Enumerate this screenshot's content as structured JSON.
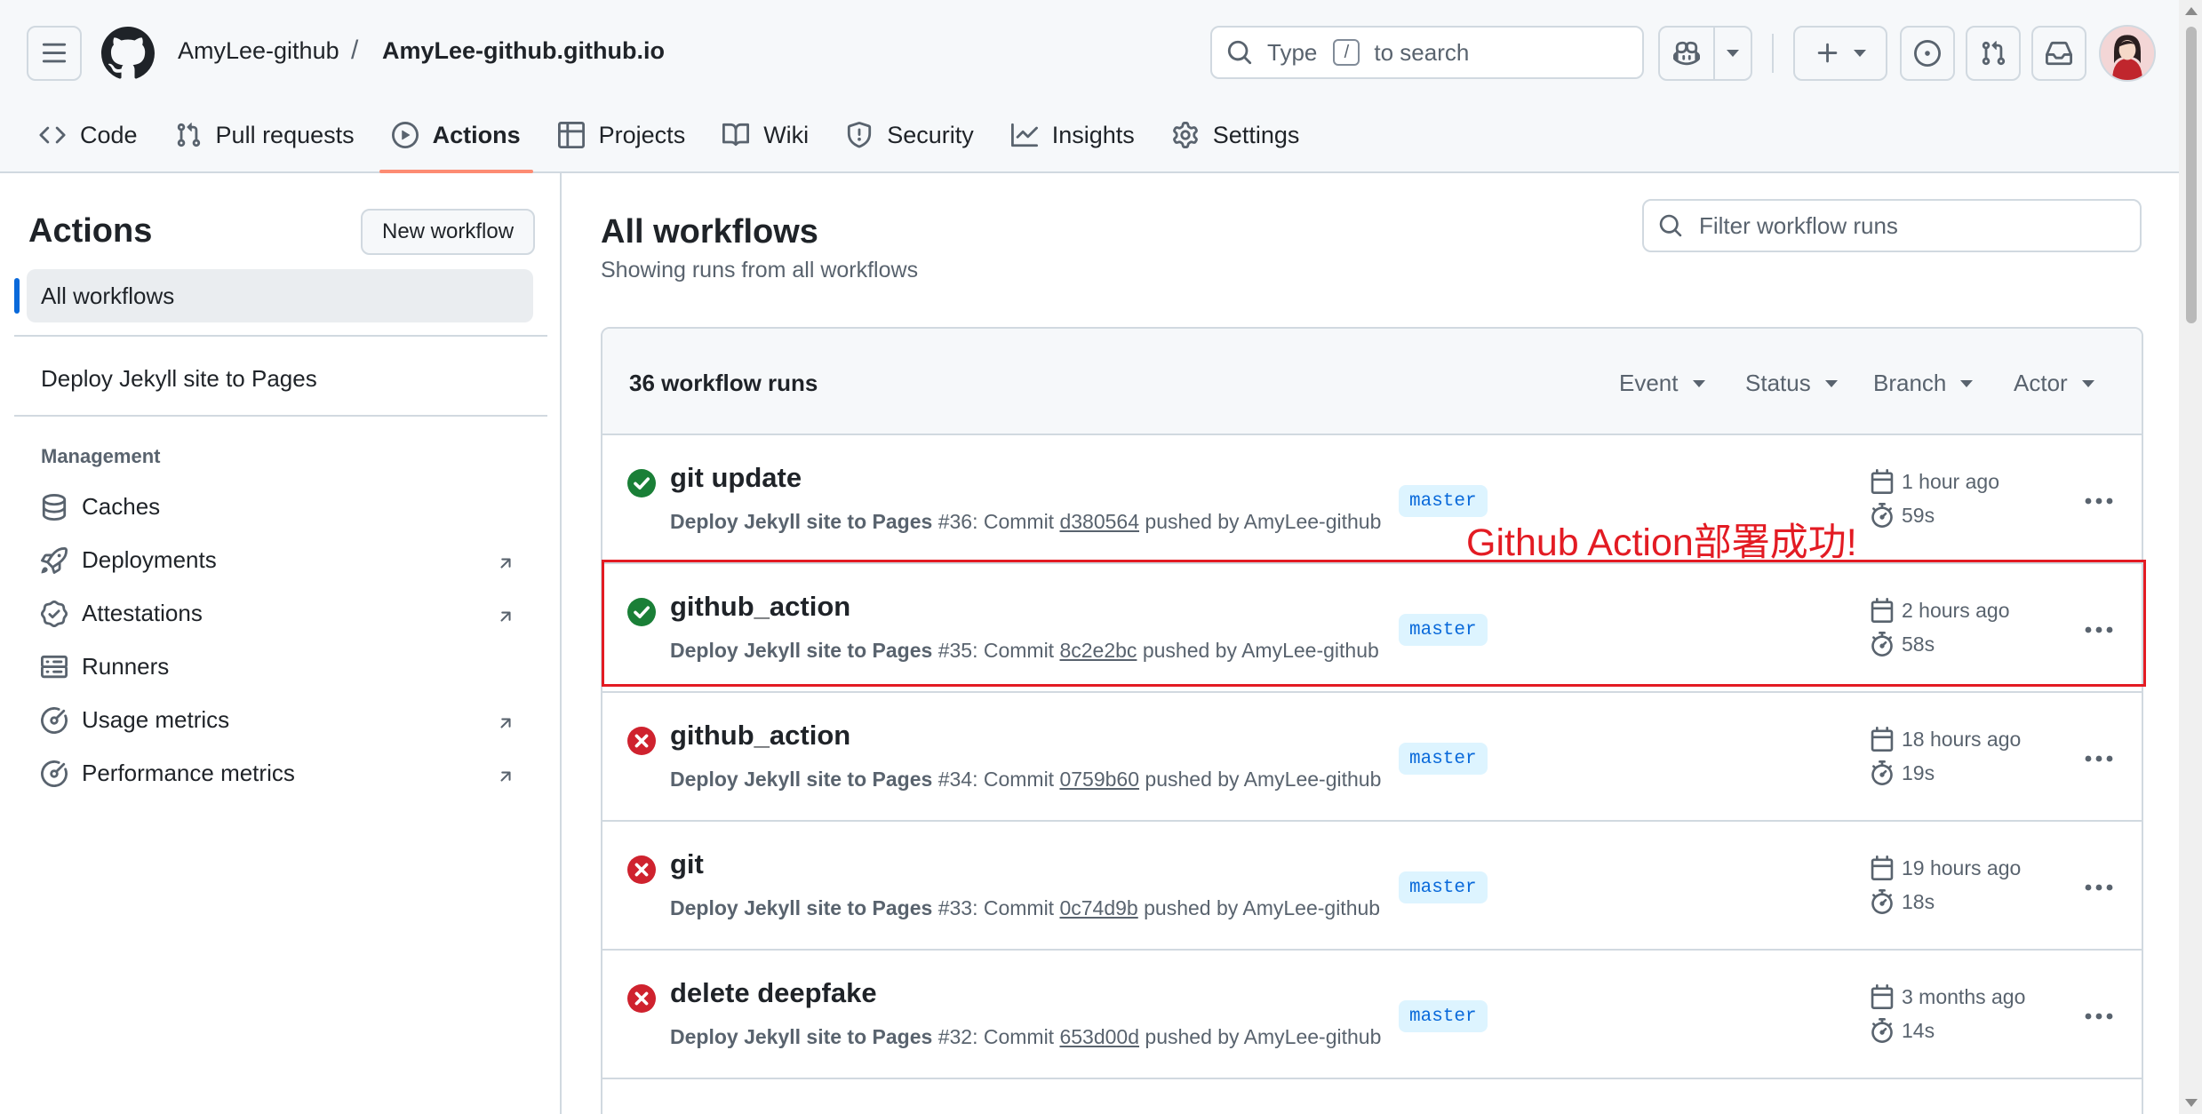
{
  "header": {
    "owner": "AmyLee-github",
    "separator": "/",
    "repo": "AmyLee-github.github.io",
    "search_prefix": "Type",
    "search_key": "/",
    "search_suffix": "to search"
  },
  "nav": {
    "tabs": [
      {
        "label": "Code",
        "icon": "code-icon"
      },
      {
        "label": "Pull requests",
        "icon": "pull-request-icon"
      },
      {
        "label": "Actions",
        "icon": "play-icon",
        "active": true
      },
      {
        "label": "Projects",
        "icon": "table-icon"
      },
      {
        "label": "Wiki",
        "icon": "book-icon"
      },
      {
        "label": "Security",
        "icon": "shield-icon"
      },
      {
        "label": "Insights",
        "icon": "graph-icon"
      },
      {
        "label": "Settings",
        "icon": "gear-icon"
      }
    ]
  },
  "sidebar": {
    "title": "Actions",
    "new_workflow": "New workflow",
    "all_workflows": "All workflows",
    "workflow": "Deploy Jekyll site to Pages",
    "management_heading": "Management",
    "items": [
      {
        "label": "Caches",
        "icon": "database-icon"
      },
      {
        "label": "Deployments",
        "icon": "rocket-icon"
      },
      {
        "label": "Attestations",
        "icon": "verified-icon"
      },
      {
        "label": "Runners",
        "icon": "server-icon"
      },
      {
        "label": "Usage metrics",
        "icon": "meter-icon"
      },
      {
        "label": "Performance metrics",
        "icon": "meter-icon"
      }
    ]
  },
  "main": {
    "title": "All workflows",
    "subtitle": "Showing runs from all workflows",
    "filter_placeholder": "Filter workflow runs",
    "run_count": "36 workflow runs",
    "filters": [
      "Event",
      "Status",
      "Branch",
      "Actor"
    ],
    "runs": [
      {
        "title": "git update",
        "status": "success",
        "workflow": "Deploy Jekyll site to Pages",
        "number": "#36",
        "commit": "d380564",
        "actor": "AmyLee-github",
        "branch": "master",
        "when": "1 hour ago",
        "duration": "59s"
      },
      {
        "title": "github_action",
        "status": "success",
        "workflow": "Deploy Jekyll site to Pages",
        "number": "#35",
        "commit": "8c2e2bc",
        "actor": "AmyLee-github",
        "branch": "master",
        "when": "2 hours ago",
        "duration": "58s"
      },
      {
        "title": "github_action",
        "status": "failure",
        "workflow": "Deploy Jekyll site to Pages",
        "number": "#34",
        "commit": "0759b60",
        "actor": "AmyLee-github",
        "branch": "master",
        "when": "18 hours ago",
        "duration": "19s"
      },
      {
        "title": "git",
        "status": "failure",
        "workflow": "Deploy Jekyll site to Pages",
        "number": "#33",
        "commit": "0c74d9b",
        "actor": "AmyLee-github",
        "branch": "master",
        "when": "19 hours ago",
        "duration": "18s"
      },
      {
        "title": "delete deepfake",
        "status": "failure",
        "workflow": "Deploy Jekyll site to Pages",
        "number": "#32",
        "commit": "653d00d",
        "actor": "AmyLee-github",
        "branch": "master",
        "when": "3 months ago",
        "duration": "14s"
      }
    ],
    "commit_word": "Commit",
    "pushed_by": "pushed by"
  },
  "annotation": {
    "text": "Github Action部署成功!",
    "color": "#e31b23"
  },
  "colors": {
    "success": "#1a7f37",
    "failure": "#cf222e",
    "accent": "#0969da",
    "tab_underline": "#fd8c73"
  }
}
